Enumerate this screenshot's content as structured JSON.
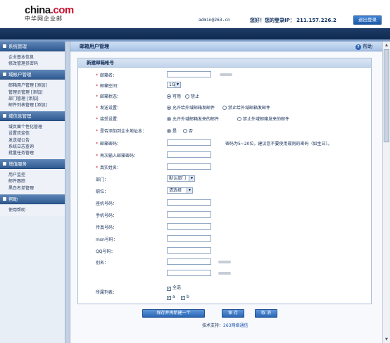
{
  "header": {
    "logo_main": "china",
    "logo_dot": ".",
    "logo_com": "com",
    "logo_sub": "中华网企业邮",
    "email": "admin@263.cn",
    "greeting": "您好！您的登录IP： 211.157.226.2",
    "logout_label": "退出登录"
  },
  "sidebar": {
    "sections": [
      {
        "title": "系统管理",
        "items": [
          "企业基本信息",
          "修改管理员密码"
        ]
      },
      {
        "title": "域帐户管理",
        "items": [
          "邮箱用户管理 [添加]",
          "管理员管理 [添加]",
          "部门管理 [添加]",
          "邮件列表管理 [添加]"
        ]
      },
      {
        "title": "域信息管理",
        "items": [
          "域页面个性化管理",
          "设置欢迎信",
          "发送域公告",
          "系统日志查询",
          "批量任务管理"
        ]
      },
      {
        "title": "增值服务",
        "items": [
          "用户监控",
          "邮件跟踪",
          "黑白名单管理"
        ]
      },
      {
        "title": "帮助",
        "items": [
          "使用帮助"
        ]
      }
    ]
  },
  "main": {
    "title": "邮箱用户管理",
    "help_label": "帮助",
    "form_title": "新建邮箱帐号",
    "fields": {
      "mailbox_name": "邮箱名：",
      "mailbox_space": "邮箱空间：",
      "space_value": "1G",
      "mailbox_status": "邮箱状态：",
      "status_on": "可用",
      "status_off": "禁止",
      "send_setting": "发送设置：",
      "send_allow": "允许给外域邮箱发邮件",
      "send_deny": "禁止给外域邮箱发邮件",
      "recv_setting": "接受设置：",
      "recv_allow": "允许外域邮箱发来的邮件",
      "recv_deny": "禁止外域邮箱发来的邮件",
      "addressbook": "是否添加到企业地址本：",
      "ab_yes": "是",
      "ab_no": "否",
      "password": "邮箱密码：",
      "password_hint": "密码为5~20位，建议您不要使用规则的密码（如生日）。",
      "password_confirm": "再次输入邮箱密码：",
      "real_name": "真实姓名：",
      "department": "部门：",
      "department_value": "默认部门",
      "position": "职位：",
      "position_value": "请选择",
      "phone": "座机号码：",
      "mobile": "手机号码：",
      "fax": "传真号码：",
      "msn": "msn号码：",
      "qq": "QQ号码：",
      "alias": "别名：",
      "list": "所属列表：",
      "select_all": "全选",
      "list_a": "a",
      "list_b": "b"
    },
    "buttons": {
      "save_continue": "保存并再新建一个",
      "save": "保 存",
      "cancel": "取 消"
    },
    "support_label": "技术支持：",
    "support_link": "263网络通信"
  },
  "colors": {
    "header_band": "#0f2a50",
    "sidebar_section": "#2f5a92",
    "required_star": "#d01818",
    "button": "#2a66b4"
  }
}
